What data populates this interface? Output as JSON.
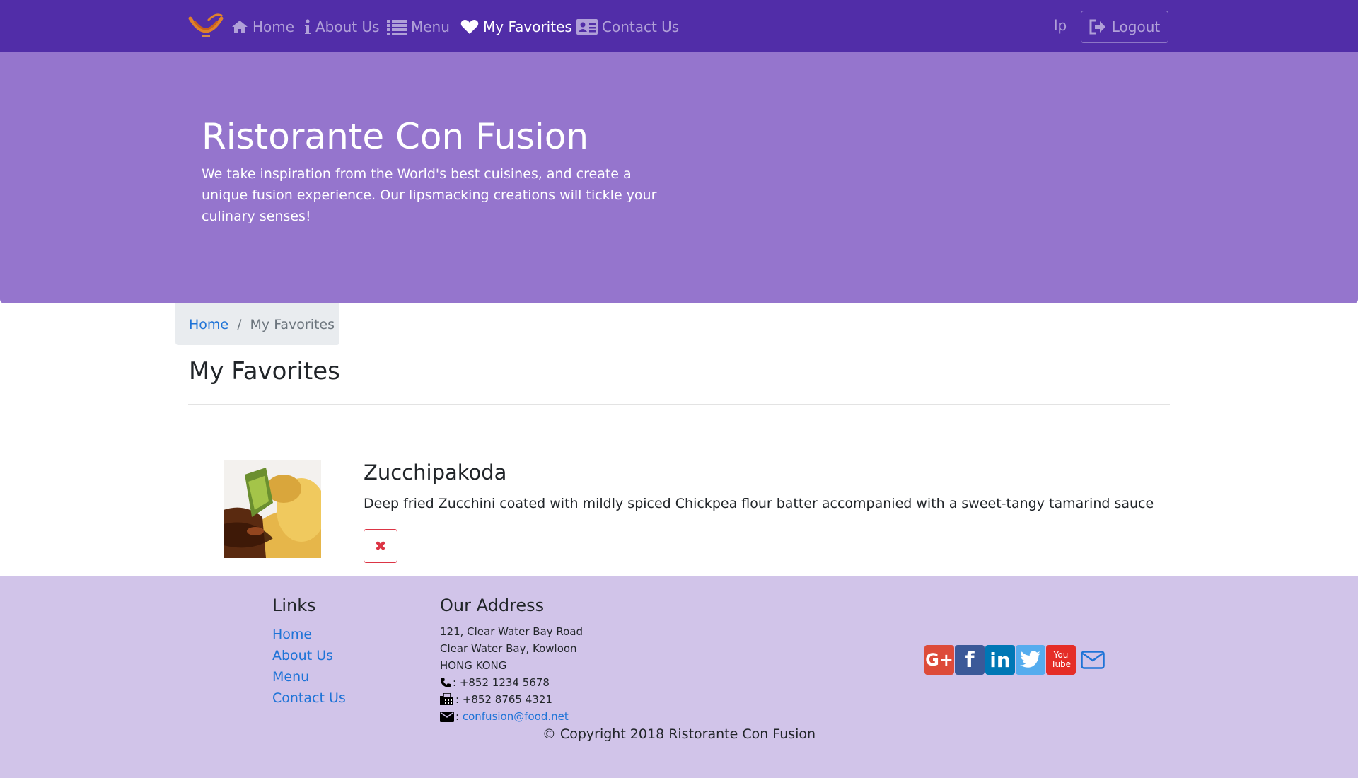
{
  "nav": {
    "items": [
      {
        "label": "Home",
        "icon": "home-icon",
        "active": false
      },
      {
        "label": "About Us",
        "icon": "info-icon",
        "active": false
      },
      {
        "label": "Menu",
        "icon": "list-icon",
        "active": false
      },
      {
        "label": "My Favorites",
        "icon": "heart-icon",
        "active": true
      },
      {
        "label": "Contact Us",
        "icon": "address-card-icon",
        "active": false
      }
    ],
    "user": "lp",
    "logout_label": "Logout"
  },
  "jumbotron": {
    "title": "Ristorante Con Fusion",
    "text": "We take inspiration from the World's best cuisines, and create a unique fusion experience. Our lipsmacking creations will tickle your culinary senses!"
  },
  "breadcrumb": {
    "home": "Home",
    "separator": "/",
    "current": "My Favorites"
  },
  "page": {
    "title": "My Favorites"
  },
  "favorites": [
    {
      "name": "Zucchipakoda",
      "description": "Deep fried Zucchini coated with mildly spiced Chickpea flour batter accompanied with a sweet-tangy tamarind sauce",
      "remove_label": "✖"
    }
  ],
  "footer": {
    "links_heading": "Links",
    "links": [
      "Home",
      "About Us",
      "Menu",
      "Contact Us"
    ],
    "address_heading": "Our Address",
    "address_lines": [
      "121, Clear Water Bay Road",
      "Clear Water Bay, Kowloon",
      "HONG KONG"
    ],
    "phone": ": +852 1234 5678",
    "fax": ": +852 8765 4321",
    "email_prefix": ":",
    "email": "confusion@food.net",
    "social": [
      "google-plus-icon",
      "facebook-icon",
      "linkedin-icon",
      "twitter-icon",
      "youtube-icon",
      "envelope-icon"
    ],
    "social_glyphs": {
      "google": "G+",
      "facebook": "f",
      "linkedin": "in",
      "youtube_top": "You",
      "youtube_bottom": "Tube"
    },
    "copyright": "© Copyright 2018 Ristorante Con Fusion"
  },
  "colors": {
    "navbar": "#512da8",
    "jumbotron": "#9575cd",
    "footer": "#d1c4e9",
    "link": "#1e73d7",
    "danger": "#dc3545",
    "google": "#dd4b39",
    "facebook": "#3b5998",
    "linkedin": "#0077b5",
    "twitter": "#55acee",
    "youtube": "#e52d27"
  }
}
